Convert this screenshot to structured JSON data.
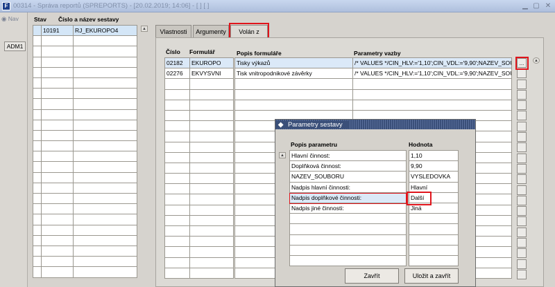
{
  "window": {
    "title": "00314 - Správa reportů (SPREPORTS) - [20.02.2019; 14:06] - [ ] [ ]",
    "min": "▁",
    "max": "▢",
    "close": "✕"
  },
  "left": {
    "nav_label": "Nav",
    "adm_button": "ADM1"
  },
  "list": {
    "col_status": "Stav",
    "col_name": "Číslo a název sestavy",
    "rows": [
      {
        "num": "10191",
        "name": "RJ_EKUROPO4"
      }
    ]
  },
  "tabs": [
    "Vlastnosti",
    "Argumenty",
    "Volán z"
  ],
  "forms": {
    "col_num": "Číslo",
    "col_form": "Formulář",
    "col_desc": "Popis formuláře",
    "col_params": "Parametry vazby",
    "rows": [
      {
        "num": "02182",
        "form": "EKUROPO",
        "desc": "Tisky výkazů",
        "params": "/* VALUES */CIN_HLV:='1,10';CIN_VDL:='9,90';NAZEV_SOU"
      },
      {
        "num": "02276",
        "form": "EKVYSVNI",
        "desc": "Tisk vnitropodnikové závěrky",
        "params": "/* VALUES */CIN_HLV:='1,10';CIN_VDL:='9,90';NAZEV_SOU"
      }
    ],
    "dots_label": "..."
  },
  "dialog": {
    "title": "Parametry sestavy",
    "col_desc": "Popis parametru",
    "col_value": "Hodnota",
    "rows": [
      {
        "desc": "Hlavní činnost:",
        "value": "1,10"
      },
      {
        "desc": "Doplňková činnost:",
        "value": "9,90"
      },
      {
        "desc": "NAZEV_SOUBORU",
        "value": "VYSLEDOVKA"
      },
      {
        "desc": "Nadpis hlavní činnosti:",
        "value": "Hlavní"
      },
      {
        "desc": "Nadpis doplňkové činnosti:",
        "value": "Další"
      },
      {
        "desc": "Nadpis jiné činnosti:",
        "value": "Jiná"
      }
    ],
    "close_button": "Zavřít",
    "save_close_button": "Uložit a zavřít"
  },
  "colors": {
    "highlight": "#e0141b",
    "selected_row": "#d4e6f7",
    "dialog_title": "#3a4f79"
  }
}
